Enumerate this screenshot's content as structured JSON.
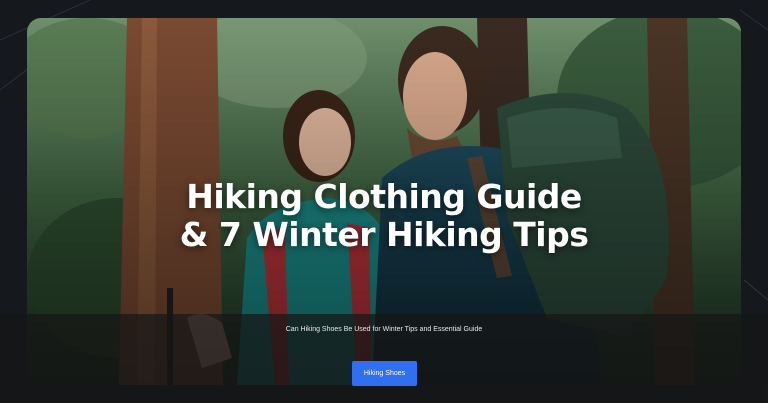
{
  "hero": {
    "title_line1": "Hiking Clothing Guide",
    "title_line2": "& 7 Winter Hiking Tips"
  },
  "overlay": {
    "caption": "Can Hiking Shoes Be Used for Winter Tips and Essential Guide",
    "button_label": "Hiking Shoes"
  },
  "colors": {
    "page_bg": "#15181c",
    "button_bg": "#2f6ff0",
    "overlay_bg": "rgba(22,22,22,0.72)"
  }
}
